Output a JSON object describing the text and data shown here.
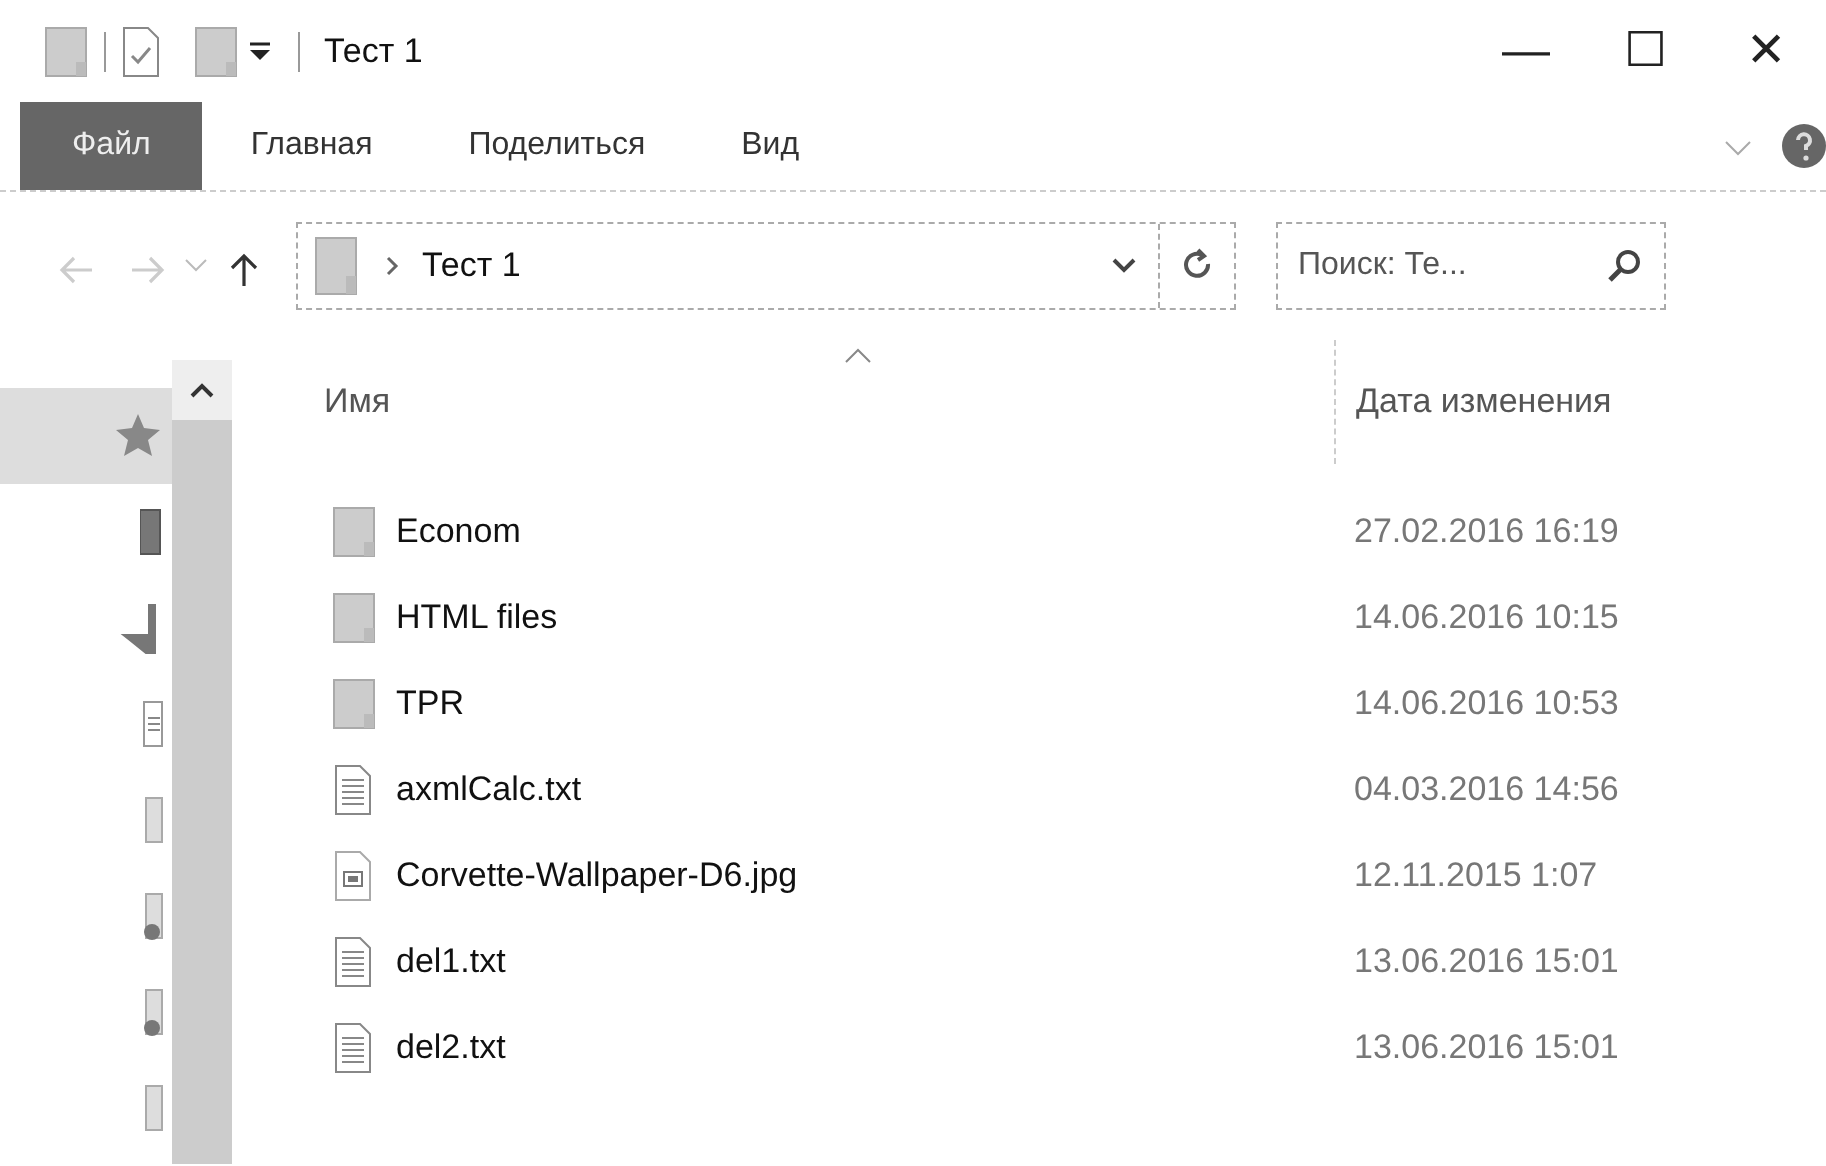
{
  "window": {
    "title": "Тест 1",
    "controls": [
      "—",
      "☐",
      "✕"
    ]
  },
  "ribbon": {
    "tabs": [
      {
        "label": "Файл",
        "kind": "file",
        "selected": false
      },
      {
        "label": "Главная",
        "kind": "tab",
        "selected": false
      },
      {
        "label": "Поделиться",
        "kind": "tab",
        "selected": false
      },
      {
        "label": "Вид",
        "kind": "tab",
        "selected": false
      }
    ]
  },
  "address": {
    "path": "Тест 1",
    "search": {
      "placeholder": "Поиск: Те..."
    }
  },
  "nav_pane": {
    "items": [
      {
        "kind": "star",
        "selected": true
      },
      {
        "kind": "desktop",
        "selected": false
      },
      {
        "kind": "download",
        "selected": false
      },
      {
        "kind": "document",
        "selected": false
      },
      {
        "kind": "folder",
        "selected": false
      },
      {
        "kind": "shared",
        "selected": false
      },
      {
        "kind": "shared",
        "selected": false
      },
      {
        "kind": "folder",
        "selected": false
      }
    ]
  },
  "table": {
    "columns": [
      "Имя",
      "Дата изменения"
    ],
    "rows": [
      {
        "kind": "folder",
        "name": "Econom",
        "date": "27.02.2016 16:19"
      },
      {
        "kind": "folder",
        "name": "HTML files",
        "date": "14.06.2016 10:15"
      },
      {
        "kind": "folder",
        "name": "TPR",
        "date": "14.06.2016 10:53"
      },
      {
        "kind": "text",
        "name": "axmlCalc.txt",
        "date": "04.03.2016 14:56"
      },
      {
        "kind": "image",
        "name": "Corvette-Wallpaper-D6.jpg",
        "date": "12.11.2015 1:07"
      },
      {
        "kind": "text",
        "name": "del1.txt",
        "date": "13.06.2016 15:01"
      },
      {
        "kind": "text",
        "name": "del2.txt",
        "date": "13.06.2016 15:01"
      }
    ]
  }
}
